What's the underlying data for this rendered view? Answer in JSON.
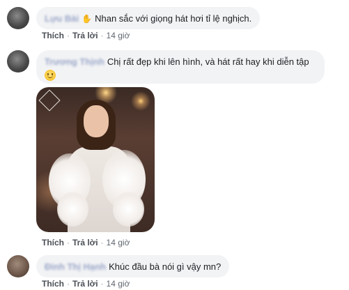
{
  "comments": [
    {
      "author": "Lựu Bài",
      "text": "Nhan sắc với giọng hát hơi tỉ lệ nghịch.",
      "actions": {
        "like": "Thích",
        "reply": "Trả lời",
        "time": "14 giờ"
      }
    },
    {
      "author": "Trương Thịnh",
      "text": "Chị rất đẹp khi lên hình, và hát rất hay khi diễn tập",
      "emoji": "smile-emoji",
      "actions": {
        "like": "Thích",
        "reply": "Trả lời",
        "time": "14 giờ"
      }
    },
    {
      "author": "Đinh Thị Hạnh",
      "text": "Khúc đầu bà nói gì vậy mn?",
      "actions": {
        "like": "Thích",
        "reply": "Trả lời",
        "time": "14 giờ"
      }
    }
  ],
  "colors": {
    "bubble": "#f2f3f5",
    "link": "#4b4f56",
    "meta": "#606770"
  }
}
